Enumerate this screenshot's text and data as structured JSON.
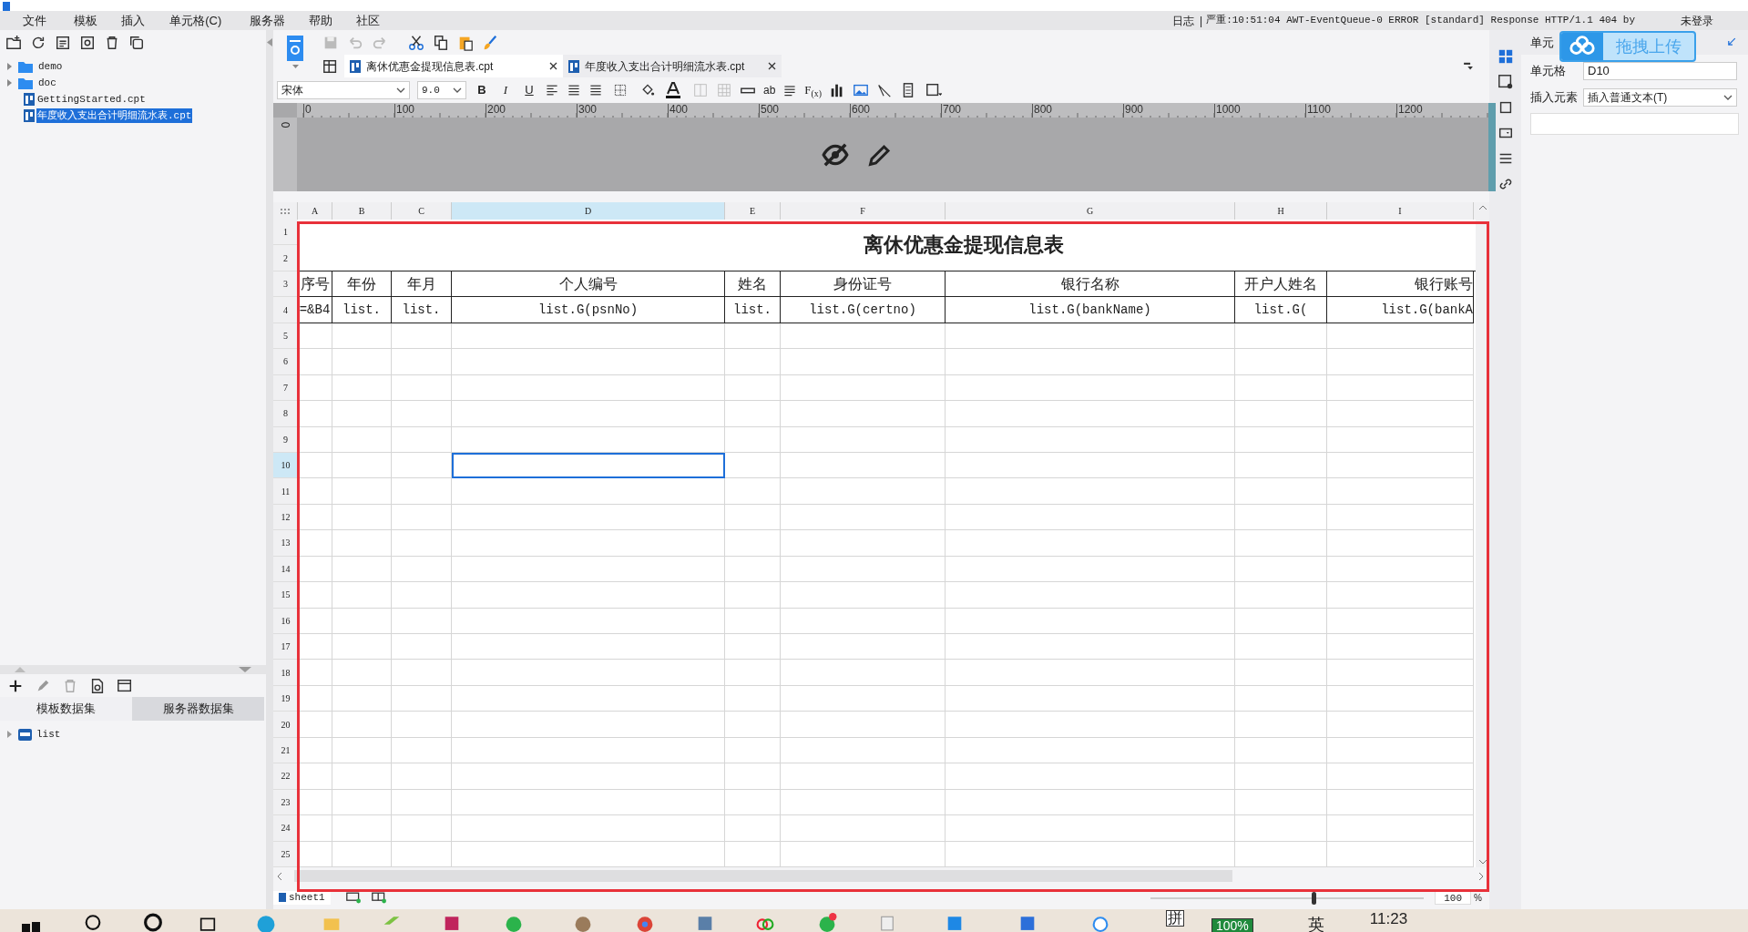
{
  "menu": [
    "文件",
    "模板",
    "插入",
    "单元格(C)",
    "服务器",
    "帮助",
    "社区"
  ],
  "log": {
    "label": "日志",
    "separator": "|",
    "message": "严重:10:51:04 AWT-EventQueue-0 ERROR [standard] Response HTTP/1.1 404  by"
  },
  "login": "未登录",
  "file_tree": [
    {
      "label": "demo",
      "kind": "folder",
      "selected": false
    },
    {
      "label": "doc",
      "kind": "folder",
      "selected": false
    },
    {
      "label": "GettingStarted.cpt",
      "kind": "file",
      "selected": false
    },
    {
      "label": "年度收入支出合计明细流水表.cpt",
      "kind": "file",
      "selected": true
    }
  ],
  "dataset_tabs": [
    {
      "label": "模板数据集",
      "selected": true
    },
    {
      "label": "服务器数据集",
      "selected": false
    }
  ],
  "datasets": [
    {
      "label": "list"
    }
  ],
  "editor_tabs": [
    {
      "label": "离休优惠金提现信息表.cpt",
      "selected": true
    },
    {
      "label": "年度收入支出合计明细流水表.cpt",
      "selected": false
    }
  ],
  "format": {
    "font": "宋体",
    "size": "9.0",
    "bold": "B",
    "italic": "I",
    "underline": "U",
    "text_tool": "ab",
    "formula": "F$_{(x)}$"
  },
  "ruler": {
    "vertical": "0",
    "ticks": [
      "0",
      "100",
      "200",
      "300",
      "400",
      "500",
      "600",
      "700",
      "800",
      "900",
      "1000",
      "1100",
      "1200"
    ]
  },
  "sheet": {
    "columns": [
      {
        "label": "A",
        "selected": false
      },
      {
        "label": "B",
        "selected": false
      },
      {
        "label": "C",
        "selected": false
      },
      {
        "label": "D",
        "selected": true
      },
      {
        "label": "E",
        "selected": false
      },
      {
        "label": "F",
        "selected": false
      },
      {
        "label": "G",
        "selected": false
      },
      {
        "label": "H",
        "selected": false
      },
      {
        "label": "I",
        "selected": false
      }
    ],
    "rows": [
      {
        "label": "1",
        "selected": false
      },
      {
        "label": "2",
        "selected": false
      },
      {
        "label": "3",
        "selected": false
      },
      {
        "label": "4",
        "selected": false
      },
      {
        "label": "5",
        "selected": false
      },
      {
        "label": "6",
        "selected": false
      },
      {
        "label": "7",
        "selected": false
      },
      {
        "label": "8",
        "selected": false
      },
      {
        "label": "9",
        "selected": false
      },
      {
        "label": "10",
        "selected": true
      },
      {
        "label": "11",
        "selected": false
      },
      {
        "label": "12",
        "selected": false
      },
      {
        "label": "13",
        "selected": false
      },
      {
        "label": "14",
        "selected": false
      },
      {
        "label": "15",
        "selected": false
      },
      {
        "label": "16",
        "selected": false
      },
      {
        "label": "17",
        "selected": false
      },
      {
        "label": "18",
        "selected": false
      },
      {
        "label": "19",
        "selected": false
      },
      {
        "label": "20",
        "selected": false
      },
      {
        "label": "21",
        "selected": false
      },
      {
        "label": "22",
        "selected": false
      },
      {
        "label": "23",
        "selected": false
      },
      {
        "label": "24",
        "selected": false
      },
      {
        "label": "25",
        "selected": false
      }
    ],
    "title": "离休优惠金提现信息表",
    "header": [
      "序号",
      "年份",
      "年月",
      "个人编号",
      "姓名",
      "身份证号",
      "银行名称",
      "开户人姓名",
      "银行账号"
    ],
    "data": [
      "=&B4",
      "list.",
      "list.",
      "list.G(psnNo)",
      "list.",
      "list.G(certno)",
      "list.G(bankName)",
      "list.G(",
      "list.G(bankA"
    ]
  },
  "sheet_tabs": [
    {
      "label": "sheet1",
      "selected": true
    }
  ],
  "zoom": {
    "value": "100",
    "unit": "%",
    "level": 0.6
  },
  "property_panel": {
    "title": "单元",
    "cell_label": "单元格",
    "cell_value": "D10",
    "insert_label": "插入元素",
    "insert_value": "插入普通文本(T)"
  },
  "upload_button": "拖拽上传",
  "taskbar": {
    "ime": "拼",
    "battery": "100%",
    "language": "英",
    "time": "11:23"
  }
}
